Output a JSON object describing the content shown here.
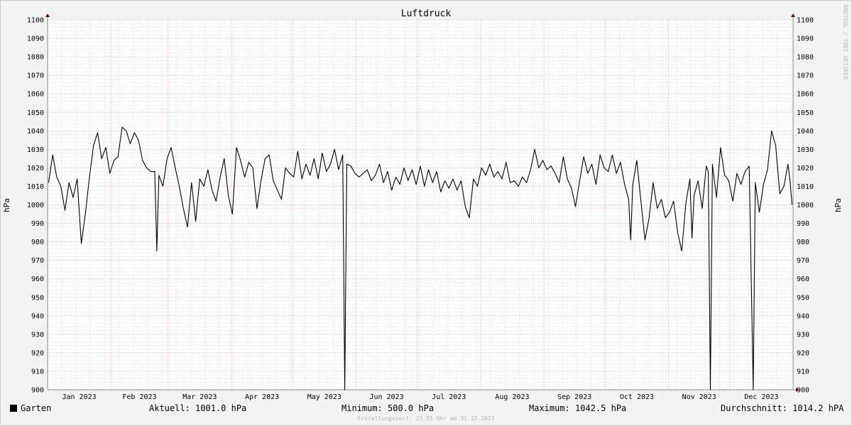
{
  "chart_data": {
    "type": "line",
    "title": "Luftdruck",
    "ylabel": "hPa",
    "ylim": [
      900,
      1100
    ],
    "yticks": [
      900,
      910,
      920,
      930,
      940,
      950,
      960,
      970,
      980,
      990,
      1000,
      1010,
      1020,
      1030,
      1040,
      1050,
      1060,
      1070,
      1080,
      1090,
      1100
    ],
    "xlim": [
      "2023-01-01",
      "2023-12-31"
    ],
    "month_ticks": [
      {
        "date": "2023-01-01",
        "label": "Jan 2023"
      },
      {
        "date": "2023-02-01",
        "label": "Feb 2023"
      },
      {
        "date": "2023-03-01",
        "label": "Mar 2023"
      },
      {
        "date": "2023-04-01",
        "label": "Apr 2023"
      },
      {
        "date": "2023-05-01",
        "label": "May 2023"
      },
      {
        "date": "2023-06-01",
        "label": "Jun 2023"
      },
      {
        "date": "2023-07-01",
        "label": "Jul 2023"
      },
      {
        "date": "2023-08-01",
        "label": "Aug 2023"
      },
      {
        "date": "2023-09-01",
        "label": "Sep 2023"
      },
      {
        "date": "2023-10-01",
        "label": "Oct 2023"
      },
      {
        "date": "2023-11-01",
        "label": "Nov 2023"
      },
      {
        "date": "2023-12-01",
        "label": "Dec 2023"
      }
    ],
    "grid": true,
    "series": [
      {
        "name": "Garten",
        "color": "#000000",
        "points": [
          [
            "2023-01-01",
            1012
          ],
          [
            "2023-01-03",
            1027
          ],
          [
            "2023-01-05",
            1015
          ],
          [
            "2023-01-07",
            1010
          ],
          [
            "2023-01-09",
            997
          ],
          [
            "2023-01-11",
            1012
          ],
          [
            "2023-01-13",
            1004
          ],
          [
            "2023-01-15",
            1014
          ],
          [
            "2023-01-17",
            979
          ],
          [
            "2023-01-19",
            995
          ],
          [
            "2023-01-21",
            1015
          ],
          [
            "2023-01-23",
            1032
          ],
          [
            "2023-01-25",
            1039
          ],
          [
            "2023-01-27",
            1025
          ],
          [
            "2023-01-29",
            1031
          ],
          [
            "2023-01-31",
            1017
          ],
          [
            "2023-02-02",
            1024
          ],
          [
            "2023-02-04",
            1026
          ],
          [
            "2023-02-06",
            1042
          ],
          [
            "2023-02-08",
            1040
          ],
          [
            "2023-02-10",
            1033
          ],
          [
            "2023-02-12",
            1039
          ],
          [
            "2023-02-14",
            1035
          ],
          [
            "2023-02-16",
            1024
          ],
          [
            "2023-02-18",
            1020
          ],
          [
            "2023-02-20",
            1018
          ],
          [
            "2023-02-22",
            1018
          ],
          [
            "2023-02-23",
            975
          ],
          [
            "2023-02-24",
            1016
          ],
          [
            "2023-02-26",
            1010
          ],
          [
            "2023-02-28",
            1025
          ],
          [
            "2023-03-02",
            1031
          ],
          [
            "2023-03-04",
            1020
          ],
          [
            "2023-03-06",
            1010
          ],
          [
            "2023-03-08",
            998
          ],
          [
            "2023-03-10",
            988
          ],
          [
            "2023-03-12",
            1012
          ],
          [
            "2023-03-14",
            991
          ],
          [
            "2023-03-16",
            1014
          ],
          [
            "2023-03-18",
            1010
          ],
          [
            "2023-03-20",
            1019
          ],
          [
            "2023-03-22",
            1008
          ],
          [
            "2023-03-24",
            1002
          ],
          [
            "2023-03-26",
            1015
          ],
          [
            "2023-03-28",
            1025
          ],
          [
            "2023-03-30",
            1005
          ],
          [
            "2023-04-01",
            995
          ],
          [
            "2023-04-03",
            1031
          ],
          [
            "2023-04-05",
            1024
          ],
          [
            "2023-04-07",
            1015
          ],
          [
            "2023-04-09",
            1023
          ],
          [
            "2023-04-11",
            1020
          ],
          [
            "2023-04-13",
            998
          ],
          [
            "2023-04-15",
            1013
          ],
          [
            "2023-04-17",
            1025
          ],
          [
            "2023-04-19",
            1027
          ],
          [
            "2023-04-21",
            1013
          ],
          [
            "2023-04-23",
            1008
          ],
          [
            "2023-04-25",
            1003
          ],
          [
            "2023-04-27",
            1020
          ],
          [
            "2023-04-29",
            1017
          ],
          [
            "2023-05-01",
            1015
          ],
          [
            "2023-05-03",
            1029
          ],
          [
            "2023-05-05",
            1014
          ],
          [
            "2023-05-07",
            1022
          ],
          [
            "2023-05-09",
            1016
          ],
          [
            "2023-05-11",
            1025
          ],
          [
            "2023-05-13",
            1014
          ],
          [
            "2023-05-15",
            1028
          ],
          [
            "2023-05-17",
            1018
          ],
          [
            "2023-05-19",
            1022
          ],
          [
            "2023-05-21",
            1030
          ],
          [
            "2023-05-23",
            1019
          ],
          [
            "2023-05-25",
            1027
          ],
          [
            "2023-05-26",
            900
          ],
          [
            "2023-05-27",
            1022
          ],
          [
            "2023-05-29",
            1021
          ],
          [
            "2023-05-31",
            1017
          ],
          [
            "2023-06-02",
            1015
          ],
          [
            "2023-06-04",
            1017
          ],
          [
            "2023-06-06",
            1019
          ],
          [
            "2023-06-08",
            1013
          ],
          [
            "2023-06-10",
            1016
          ],
          [
            "2023-06-12",
            1022
          ],
          [
            "2023-06-14",
            1012
          ],
          [
            "2023-06-16",
            1018
          ],
          [
            "2023-06-18",
            1008
          ],
          [
            "2023-06-20",
            1015
          ],
          [
            "2023-06-22",
            1011
          ],
          [
            "2023-06-24",
            1020
          ],
          [
            "2023-06-26",
            1013
          ],
          [
            "2023-06-28",
            1019
          ],
          [
            "2023-06-30",
            1011
          ],
          [
            "2023-07-02",
            1021
          ],
          [
            "2023-07-04",
            1010
          ],
          [
            "2023-07-06",
            1019
          ],
          [
            "2023-07-08",
            1012
          ],
          [
            "2023-07-10",
            1018
          ],
          [
            "2023-07-12",
            1007
          ],
          [
            "2023-07-14",
            1013
          ],
          [
            "2023-07-16",
            1009
          ],
          [
            "2023-07-18",
            1014
          ],
          [
            "2023-07-20",
            1008
          ],
          [
            "2023-07-22",
            1013
          ],
          [
            "2023-07-24",
            999
          ],
          [
            "2023-07-26",
            993
          ],
          [
            "2023-07-28",
            1014
          ],
          [
            "2023-07-30",
            1010
          ],
          [
            "2023-08-01",
            1020
          ],
          [
            "2023-08-03",
            1016
          ],
          [
            "2023-08-05",
            1022
          ],
          [
            "2023-08-07",
            1015
          ],
          [
            "2023-08-09",
            1018
          ],
          [
            "2023-08-11",
            1014
          ],
          [
            "2023-08-13",
            1023
          ],
          [
            "2023-08-15",
            1012
          ],
          [
            "2023-08-17",
            1013
          ],
          [
            "2023-08-19",
            1010
          ],
          [
            "2023-08-21",
            1015
          ],
          [
            "2023-08-23",
            1012
          ],
          [
            "2023-08-25",
            1019
          ],
          [
            "2023-08-27",
            1030
          ],
          [
            "2023-08-29",
            1020
          ],
          [
            "2023-08-31",
            1024
          ],
          [
            "2023-09-02",
            1019
          ],
          [
            "2023-09-04",
            1021
          ],
          [
            "2023-09-06",
            1017
          ],
          [
            "2023-09-08",
            1012
          ],
          [
            "2023-09-10",
            1026
          ],
          [
            "2023-09-12",
            1014
          ],
          [
            "2023-09-14",
            1009
          ],
          [
            "2023-09-16",
            999
          ],
          [
            "2023-09-18",
            1013
          ],
          [
            "2023-09-20",
            1026
          ],
          [
            "2023-09-22",
            1017
          ],
          [
            "2023-09-24",
            1022
          ],
          [
            "2023-09-26",
            1011
          ],
          [
            "2023-09-28",
            1027
          ],
          [
            "2023-09-30",
            1020
          ],
          [
            "2023-10-02",
            1018
          ],
          [
            "2023-10-04",
            1027
          ],
          [
            "2023-10-06",
            1017
          ],
          [
            "2023-10-08",
            1023
          ],
          [
            "2023-10-10",
            1011
          ],
          [
            "2023-10-12",
            1003
          ],
          [
            "2023-10-13",
            981
          ],
          [
            "2023-10-14",
            1011
          ],
          [
            "2023-10-16",
            1024
          ],
          [
            "2023-10-18",
            1002
          ],
          [
            "2023-10-20",
            981
          ],
          [
            "2023-10-22",
            993
          ],
          [
            "2023-10-24",
            1012
          ],
          [
            "2023-10-26",
            998
          ],
          [
            "2023-10-28",
            1003
          ],
          [
            "2023-10-30",
            993
          ],
          [
            "2023-11-01",
            996
          ],
          [
            "2023-11-03",
            1002
          ],
          [
            "2023-11-05",
            985
          ],
          [
            "2023-11-07",
            975
          ],
          [
            "2023-11-09",
            1001
          ],
          [
            "2023-11-11",
            1014
          ],
          [
            "2023-11-12",
            982
          ],
          [
            "2023-11-13",
            1005
          ],
          [
            "2023-11-15",
            1013
          ],
          [
            "2023-11-17",
            998
          ],
          [
            "2023-11-19",
            1021
          ],
          [
            "2023-11-20",
            1018
          ],
          [
            "2023-11-21",
            900
          ],
          [
            "2023-11-22",
            1022
          ],
          [
            "2023-11-24",
            1004
          ],
          [
            "2023-11-26",
            1031
          ],
          [
            "2023-11-28",
            1016
          ],
          [
            "2023-11-30",
            1013
          ],
          [
            "2023-12-02",
            1002
          ],
          [
            "2023-12-04",
            1017
          ],
          [
            "2023-12-06",
            1011
          ],
          [
            "2023-12-08",
            1018
          ],
          [
            "2023-12-10",
            1021
          ],
          [
            "2023-12-12",
            900
          ],
          [
            "2023-12-13",
            1012
          ],
          [
            "2023-12-15",
            996
          ],
          [
            "2023-12-17",
            1011
          ],
          [
            "2023-12-19",
            1019
          ],
          [
            "2023-12-21",
            1040
          ],
          [
            "2023-12-23",
            1032
          ],
          [
            "2023-12-25",
            1006
          ],
          [
            "2023-12-27",
            1010
          ],
          [
            "2023-12-29",
            1022
          ],
          [
            "2023-12-30",
            1013
          ],
          [
            "2023-12-31",
            1000
          ]
        ]
      }
    ]
  },
  "legend": {
    "name": "Garten",
    "current": "Aktuell: 1001.0 hPa",
    "minimum": "Minimum: 500.0 hPa",
    "maximum": "Maximum: 1042.5 hPa",
    "average": "Durchschnitt: 1014.2 hPA"
  },
  "watermark": "RRDTOOL / TOBI OETIKER",
  "footer": "Erstellungszeit: 23:55 Uhr am 31.12.2023"
}
